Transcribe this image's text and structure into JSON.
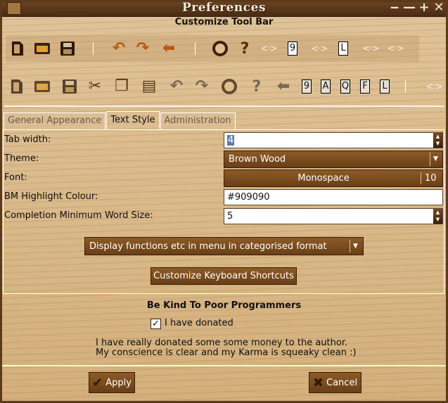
{
  "window": {
    "title": "Preferences"
  },
  "toolbar_section": {
    "title": "Customize Tool Bar"
  },
  "toolbar_current": {
    "items": [
      {
        "icon": "new-document-icon"
      },
      {
        "icon": "open-folder-icon"
      },
      {
        "icon": "save-disk-icon"
      },
      {
        "icon": "separator"
      },
      {
        "icon": "undo-icon"
      },
      {
        "icon": "redo-icon"
      },
      {
        "icon": "back-arrow-icon"
      },
      {
        "icon": "separator"
      },
      {
        "icon": "find-icon"
      },
      {
        "icon": "help-icon"
      },
      {
        "icon": "link-arrows-icon"
      },
      {
        "icon": "letter",
        "text": "9"
      },
      {
        "icon": "link-arrows-icon"
      },
      {
        "icon": "letter",
        "text": "L"
      },
      {
        "icon": "link-arrows-icon"
      },
      {
        "icon": "link-arrows-icon"
      }
    ]
  },
  "toolbar_available": {
    "letters": [
      "9",
      "A",
      "Q",
      "F",
      "L"
    ]
  },
  "tabs": [
    {
      "label": "General Appearance",
      "active": false
    },
    {
      "label": "Text Style",
      "active": true
    },
    {
      "label": "Administration",
      "active": false
    }
  ],
  "form": {
    "tab_width_label": "Tab width:",
    "tab_width_value": "4",
    "theme_label": "Theme:",
    "theme_value": "Brown Wood",
    "font_label": "Font:",
    "font_name": "Monospace",
    "font_size": "10",
    "bm_label": "BM Highlight Colour:",
    "bm_value": "#909090",
    "completion_label": "Completion Minimum Word Size:",
    "completion_value": "5",
    "display_combo": "Display functions etc in menu in categorised format",
    "shortcuts_button": "Customize Keyboard Shortcuts"
  },
  "donate": {
    "title": "Be Kind To Poor Programmers",
    "checkbox_label": "I have donated",
    "checked": true,
    "line1": "I have really donated some some money to the author.",
    "line2": "My conscience is clear and my Karma is squeaky clean :)"
  },
  "actions": {
    "apply": "Apply",
    "cancel": "Cancel"
  },
  "colors": {
    "titlebar": "#4a2c12",
    "button": "#7a4a1c",
    "wood": "#d9b886"
  }
}
